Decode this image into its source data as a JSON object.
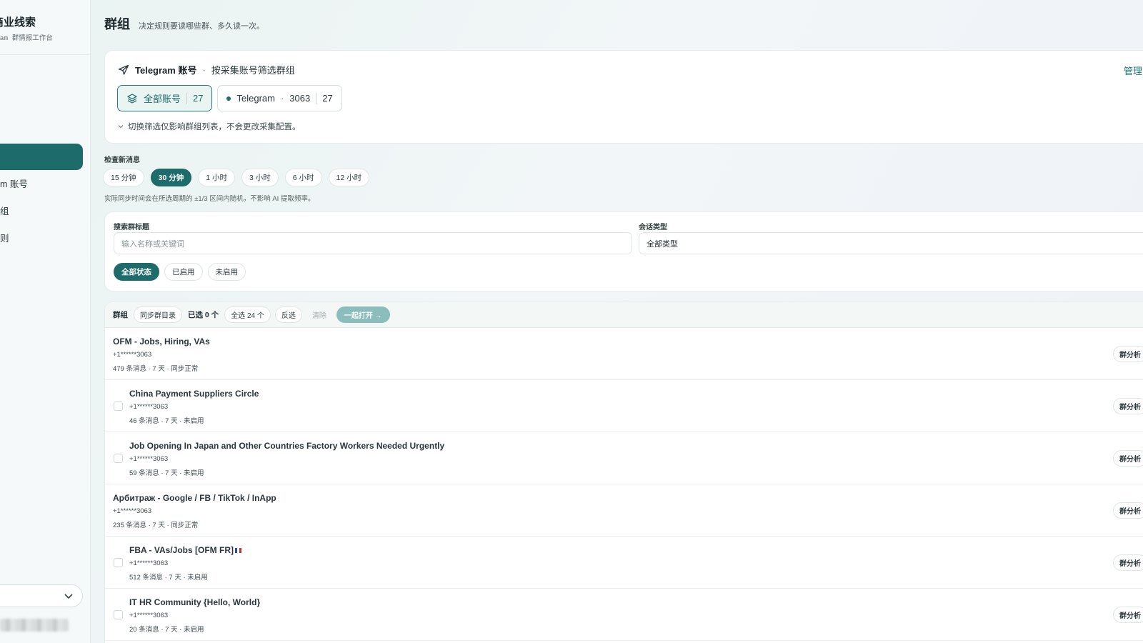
{
  "sidebar": {
    "brand_title": "商业线索",
    "brand_sub": "ram 群情报工作台",
    "items": [
      {
        "label": "m 账号"
      },
      {
        "label": "组"
      },
      {
        "label": "则"
      }
    ]
  },
  "header": {
    "title": "群组",
    "description": "决定规则要读哪些群、多久读一次。"
  },
  "accounts": {
    "title": "Telegram 账号",
    "separator": "·",
    "subtitle": "按采集账号筛选群组",
    "manage_label": "管理",
    "all_label": "全部账号",
    "all_count": "27",
    "account_name": "Telegram",
    "account_sep": "·",
    "account_id": "3063",
    "account_count": "27",
    "note": "切换筛选仅影响群组列表，不会更改采集配置。"
  },
  "interval": {
    "label": "检查新消息",
    "options": [
      "15 分钟",
      "30 分钟",
      "1 小时",
      "3 小时",
      "6 小时",
      "12 小时"
    ],
    "selected": "30 分钟",
    "note": "实际同步时间会在所选周期的 ±1/3 区间内随机，不影响 AI 提取频率。"
  },
  "filters": {
    "search_label": "搜索群标题",
    "search_placeholder": "输入名称或关键词",
    "type_label": "会话类型",
    "type_value": "全部类型",
    "status_options": [
      "全部状态",
      "已启用",
      "未启用"
    ],
    "status_selected": "全部状态"
  },
  "toolbar": {
    "title": "群组",
    "sync_label": "同步群目录",
    "selected_label": "已选 0 个",
    "select_all_label": "全选 24 个",
    "invert_label": "反选",
    "clear_label": "清除",
    "open_label": "一起打开 →"
  },
  "groups": [
    {
      "title": "OFM - Jobs, Hiring, VAs",
      "phone": "+1******3063",
      "meta": "479 条消息 · 7 天 · 同步正常",
      "checkbox": false,
      "analyze": "群分析"
    },
    {
      "title": "China Payment Suppliers Circle",
      "phone": "+1******3063",
      "meta": "46 条消息 · 7 天 · 未启用",
      "checkbox": true,
      "analyze": "群分析"
    },
    {
      "title": "Job Opening In Japan and Other Countries Factory Workers Needed Urgently",
      "phone": "+1******3063",
      "meta": "59 条消息 · 7 天 · 未启用",
      "checkbox": true,
      "analyze": "群分析"
    },
    {
      "title": "Арбитраж - Google / FB / TikTok / InApp",
      "phone": "+1******3063",
      "meta": "235 条消息 · 7 天 · 同步正常",
      "checkbox": false,
      "analyze": "群分析"
    },
    {
      "title": "FBA - VAs/Jobs [OFM FR]",
      "phone": "+1******3063",
      "meta": "512 条消息 · 7 天 · 未启用",
      "checkbox": true,
      "analyze": "群分析",
      "flag": true
    },
    {
      "title": "IT HR Community {Hello, World}",
      "phone": "+1******3063",
      "meta": "20 条消息 · 7 天 · 未启用",
      "checkbox": true,
      "analyze": "群分析"
    }
  ],
  "colors": {
    "accent": "#1e6b6b",
    "accent_light": "#8cbdbd"
  }
}
